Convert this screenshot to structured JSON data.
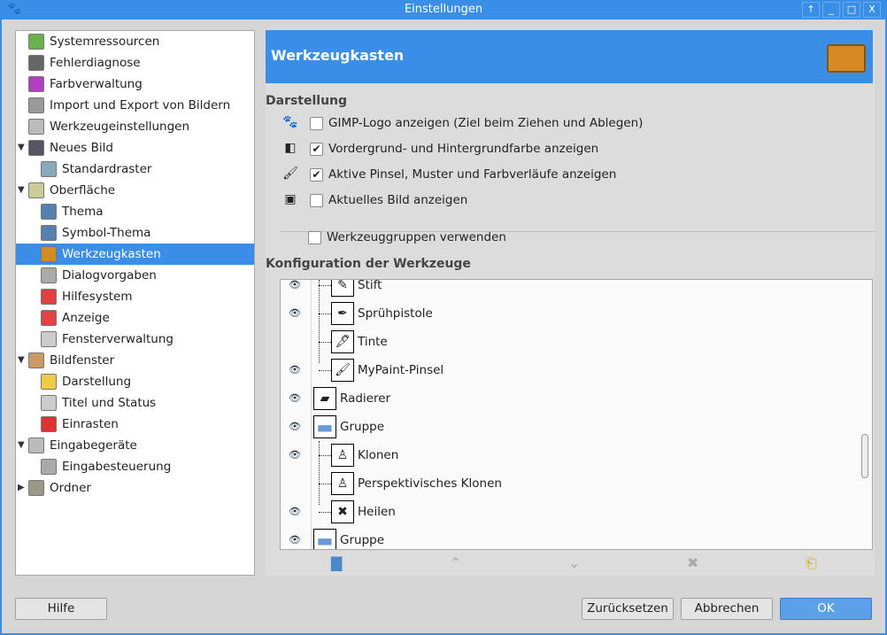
{
  "window": {
    "title": "Einstellungen",
    "controls": [
      "↑",
      "_",
      "□",
      "X"
    ]
  },
  "sidebar": {
    "items": [
      {
        "label": "Systemressourcen",
        "level": 0,
        "icon": "memory-icon",
        "color": "#6ab04c"
      },
      {
        "label": "Fehlerdiagnose",
        "level": 0,
        "icon": "wilber-icon",
        "color": "#666"
      },
      {
        "label": "Farbverwaltung",
        "level": 0,
        "icon": "color-icon",
        "color": "#b040c0"
      },
      {
        "label": "Import und Export von Bildern",
        "level": 0,
        "icon": "import-export-icon",
        "color": "#999"
      },
      {
        "label": "Werkzeugeinstellungen",
        "level": 0,
        "icon": "tool-options-icon",
        "color": "#bbb"
      },
      {
        "label": "Neues Bild",
        "level": 0,
        "icon": "new-image-icon",
        "color": "#556",
        "expander": "▼"
      },
      {
        "label": "Standardraster",
        "level": 1,
        "icon": "grid-icon",
        "color": "#8ab"
      },
      {
        "label": "Oberfläche",
        "level": 0,
        "icon": "interface-icon",
        "color": "#cc9",
        "expander": "▼"
      },
      {
        "label": "Thema",
        "level": 1,
        "icon": "theme-icon",
        "color": "#5580b0"
      },
      {
        "label": "Symbol-Thema",
        "level": 1,
        "icon": "icon-theme-icon",
        "color": "#5580b0"
      },
      {
        "label": "Werkzeugkasten",
        "level": 1,
        "icon": "toolbox-icon",
        "color": "#d68a24",
        "selected": true
      },
      {
        "label": "Dialogvorgaben",
        "level": 1,
        "icon": "dialog-defaults-icon",
        "color": "#aaa"
      },
      {
        "label": "Hilfesystem",
        "level": 1,
        "icon": "help-lifebuoy-icon",
        "color": "#e04040"
      },
      {
        "label": "Anzeige",
        "level": 1,
        "icon": "display-icon",
        "color": "#d44"
      },
      {
        "label": "Fensterverwaltung",
        "level": 1,
        "icon": "window-management-icon",
        "color": "#ccc"
      },
      {
        "label": "Bildfenster",
        "level": 0,
        "icon": "image-window-icon",
        "color": "#c96",
        "expander": "▼"
      },
      {
        "label": "Darstellung",
        "level": 1,
        "icon": "appearance-icon",
        "color": "#ec4"
      },
      {
        "label": "Titel und Status",
        "level": 1,
        "icon": "title-status-icon",
        "color": "#ccc"
      },
      {
        "label": "Einrasten",
        "level": 1,
        "icon": "snap-magnet-icon",
        "color": "#d33"
      },
      {
        "label": "Eingabegeräte",
        "level": 0,
        "icon": "input-devices-icon",
        "color": "#bbb",
        "expander": "▼"
      },
      {
        "label": "Eingabesteuerung",
        "level": 1,
        "icon": "input-controllers-icon",
        "color": "#aaa"
      },
      {
        "label": "Ordner",
        "level": 0,
        "icon": "folders-icon",
        "color": "#998",
        "expander": "▶"
      }
    ]
  },
  "header": {
    "title": "Werkzeugkasten"
  },
  "appearance": {
    "title": "Darstellung",
    "options": [
      {
        "label": "GIMP-Logo anzeigen (Ziel beim Ziehen und Ablegen)",
        "checked": false,
        "icon": "wilber-icon"
      },
      {
        "label": "Vordergrund- und Hintergrundfarbe anzeigen",
        "checked": true,
        "icon": "fg-bg-color-icon"
      },
      {
        "label": "Aktive Pinsel, Muster und Farbverläufe anzeigen",
        "checked": true,
        "icon": "brush-icon"
      },
      {
        "label": "Aktuelles Bild anzeigen",
        "checked": false,
        "icon": "image-icon"
      }
    ],
    "groups_option": {
      "label": "Werkzeuggruppen verwenden",
      "checked": false
    }
  },
  "tools_config": {
    "title": "Konfiguration der Werkzeuge",
    "rows": [
      {
        "label": "Stift",
        "visible": true,
        "child": true,
        "icon": "pencil-icon",
        "glyph": "✎"
      },
      {
        "label": "Sprühpistole",
        "visible": true,
        "child": true,
        "icon": "airbrush-icon",
        "glyph": "✒"
      },
      {
        "label": "Tinte",
        "visible": false,
        "child": true,
        "icon": "ink-icon",
        "glyph": "🖋"
      },
      {
        "label": "MyPaint-Pinsel",
        "visible": true,
        "child": true,
        "icon": "mypaint-brush-icon",
        "glyph": "🖌"
      },
      {
        "label": "Radierer",
        "visible": true,
        "child": false,
        "icon": "eraser-icon",
        "glyph": "▰"
      },
      {
        "label": "Gruppe",
        "visible": true,
        "child": false,
        "icon": "folder-icon",
        "glyph": "▬"
      },
      {
        "label": "Klonen",
        "visible": true,
        "child": true,
        "icon": "clone-icon",
        "glyph": "♙"
      },
      {
        "label": "Perspektivisches Klonen",
        "visible": false,
        "child": true,
        "icon": "perspective-clone-icon",
        "glyph": "♙"
      },
      {
        "label": "Heilen",
        "visible": true,
        "child": true,
        "icon": "heal-icon",
        "glyph": "✖"
      },
      {
        "label": "Gruppe",
        "visible": true,
        "child": false,
        "icon": "folder-icon",
        "glyph": "▬"
      }
    ]
  },
  "footer": {
    "help": "Hilfe",
    "reset": "Zurücksetzen",
    "cancel": "Abbrechen",
    "ok": "OK"
  }
}
